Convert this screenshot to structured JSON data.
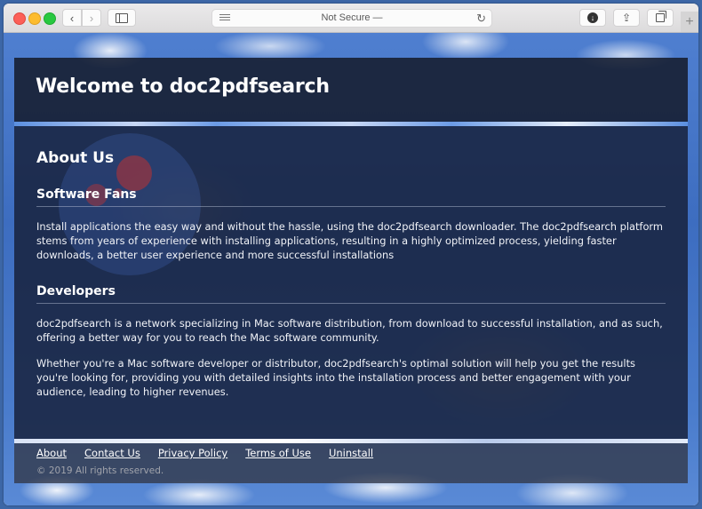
{
  "browser": {
    "address_bar_text": "Not Secure —",
    "icons": {
      "back": "‹",
      "forward": "›",
      "reload": "↻",
      "download": "↓",
      "share": "⇪",
      "new_tab": "+"
    }
  },
  "header": {
    "title": "Welcome to doc2pdfsearch"
  },
  "main": {
    "heading": "About Us",
    "sections": [
      {
        "title": "Software Fans",
        "paragraphs": [
          "Install applications the easy way and without the hassle, using the doc2pdfsearch downloader. The doc2pdfsearch platform stems from years of experience with installing applications, resulting in a highly optimized process, yielding faster downloads, a better user experience and more successful installations"
        ]
      },
      {
        "title": "Developers",
        "paragraphs": [
          "doc2pdfsearch is a network specializing in Mac software distribution, from download to successful installation, and as such, offering a better way for you to reach the Mac software community.",
          "Whether you're a Mac software developer or distributor, doc2pdfsearch's optimal solution will help you get the results you're looking for, providing you with detailed insights into the installation process and better engagement with your audience, leading to higher revenues."
        ]
      }
    ]
  },
  "footer": {
    "links": [
      "About",
      "Contact Us",
      "Privacy Policy",
      "Terms of Use",
      "Uninstall"
    ],
    "copyright": "© 2019 All rights reserved."
  }
}
